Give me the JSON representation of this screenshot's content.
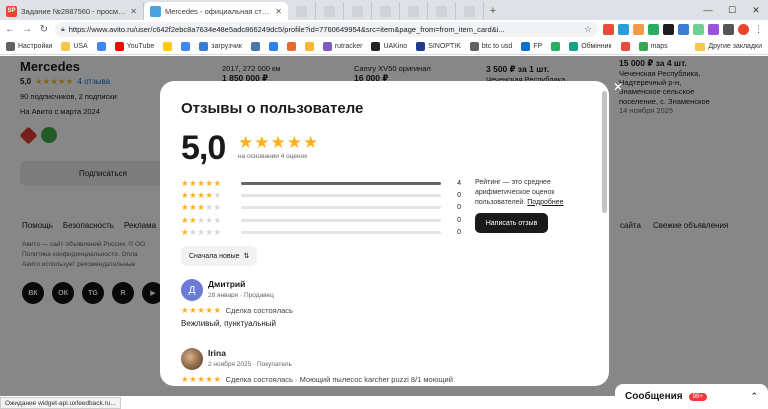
{
  "browser": {
    "tabs": [
      {
        "title": "Задание №2887560 - просмотр з",
        "favicon_text": "SP",
        "favicon_color": "#e8452c",
        "active": false
      },
      {
        "title": "Mercedes - официальная страни",
        "favicon_text": "",
        "favicon_color": "#4aa3df",
        "active": true
      }
    ],
    "mini_tabs_count": 7,
    "new_tab": "+",
    "window_controls": [
      "—",
      "☐",
      "✕"
    ],
    "url": "https://www.avito.ru/user/c642f2ebc8a7634e48e5adc866249dc5/profile?id=7760649954&src=item&page_from=from_item_card&i...",
    "bookmarks": [
      {
        "label": "Настройки",
        "color": "#5f6368"
      },
      {
        "label": "USA",
        "color": "#f2c94c"
      },
      {
        "label": "",
        "color": "#4285f4"
      },
      {
        "label": "YouTube",
        "color": "#ff0000"
      },
      {
        "label": "",
        "color": "#ffcc00"
      },
      {
        "label": "",
        "color": "#4285f4"
      },
      {
        "label": "загрузчик",
        "color": "#3a7bd5"
      },
      {
        "label": "",
        "color": "#4a76a8"
      },
      {
        "label": "",
        "color": "#2f80ed"
      },
      {
        "label": "",
        "color": "#e86a33"
      },
      {
        "label": "",
        "color": "#f7b731"
      },
      {
        "label": "rutracker",
        "color": "#7a5cc2"
      },
      {
        "label": "UAKino",
        "color": "#222222"
      },
      {
        "label": "SINOPTIK",
        "color": "#1d3b8f"
      },
      {
        "label": "btc to usd",
        "color": "#5f6368"
      },
      {
        "label": "FP",
        "color": "#0a6fd1"
      },
      {
        "label": "",
        "color": "#27ae60"
      },
      {
        "label": "Обмінник",
        "color": "#16a085"
      },
      {
        "label": "",
        "color": "#e74c3c"
      },
      {
        "label": "maps",
        "color": "#34a853"
      }
    ],
    "bookmarks_other": "Другие закладки",
    "status_text": "Ожидание widget-api.uxfeedback.ru..."
  },
  "seller": {
    "name": "Mercedes",
    "rating": "5,0",
    "stars": "★★★★★",
    "reviews_link": "4 отзыва",
    "subscribers": "90 подписчиков, 2 подписки",
    "since": "На Авито с марта 2024",
    "subscribe_button": "Подписаться"
  },
  "listings": [
    {
      "line1": "2017, 272 000 км",
      "price": "1 850 000 ₽"
    },
    {
      "line1": "Camry XV50 оригинал",
      "price": "16 000 ₽"
    },
    {
      "line1": "3 500 ₽ за 1 шт.",
      "price": "",
      "line2": "Чеченская Республика"
    },
    {
      "line1": "15 000 ₽ за 4 шт.",
      "line2": "Чеченская Республика,",
      "line3": "Надтеречный р-н,",
      "line4": "Знаменское сельское",
      "line5": "поселение, с. Знаменское",
      "line6": "14 ноября 2025"
    }
  ],
  "footer": {
    "links": [
      "Помощь",
      "Безопасность",
      "Реклама"
    ],
    "right_links": [
      "сайта",
      "Свежие объявления"
    ],
    "legal1": "Авито — сайт объявлений России. © ОО",
    "legal2": "Политика конфиденциальности. Опла",
    "legal3": "Авито использует рекомендательные",
    "socials": [
      "ВК",
      "ОК",
      "TG",
      "R",
      "▶"
    ]
  },
  "messages": {
    "label": "Сообщения",
    "count": "99+",
    "chevron": "⌃"
  },
  "modal": {
    "title": "Отзывы о пользователе",
    "score": "5,0",
    "based_on": "на основании 4 оценок",
    "histogram": [
      {
        "stars": 5,
        "count": 4,
        "fraction": 1.0
      },
      {
        "stars": 4,
        "count": 0,
        "fraction": 0.0
      },
      {
        "stars": 3,
        "count": 0,
        "fraction": 0.0
      },
      {
        "stars": 2,
        "count": 0,
        "fraction": 0.0
      },
      {
        "stars": 1,
        "count": 0,
        "fraction": 0.0
      }
    ],
    "info_text": "Рейтинг — это среднее арифметическое оценок пользователей.",
    "info_link": "Подробнее",
    "write_button": "Написать отзыв",
    "sort_button": "Сначала новые",
    "close": "✕",
    "reviews": [
      {
        "avatar_letter": "Д",
        "name": "Дмитрий",
        "meta": "28 января · Продавец",
        "stars": "★★★★★",
        "deal": "Сделка состоялась",
        "text": "Вежливый, пунктуальный"
      },
      {
        "avatar_letter": "",
        "name": "Irina",
        "meta": "2 ноября 2025 · Покупатель",
        "stars": "★★★★★",
        "deal": "Сделка состоялась · Моющий пылесос karcher puzzi 8/1 моющий",
        "text": ""
      }
    ]
  },
  "colors": {
    "star": "#ffb021",
    "link": "#0a6fd1",
    "overlay": "rgba(0,0,0,0.47)",
    "button_dark": "#1a1a1a",
    "badge_red": "#f3393e"
  }
}
